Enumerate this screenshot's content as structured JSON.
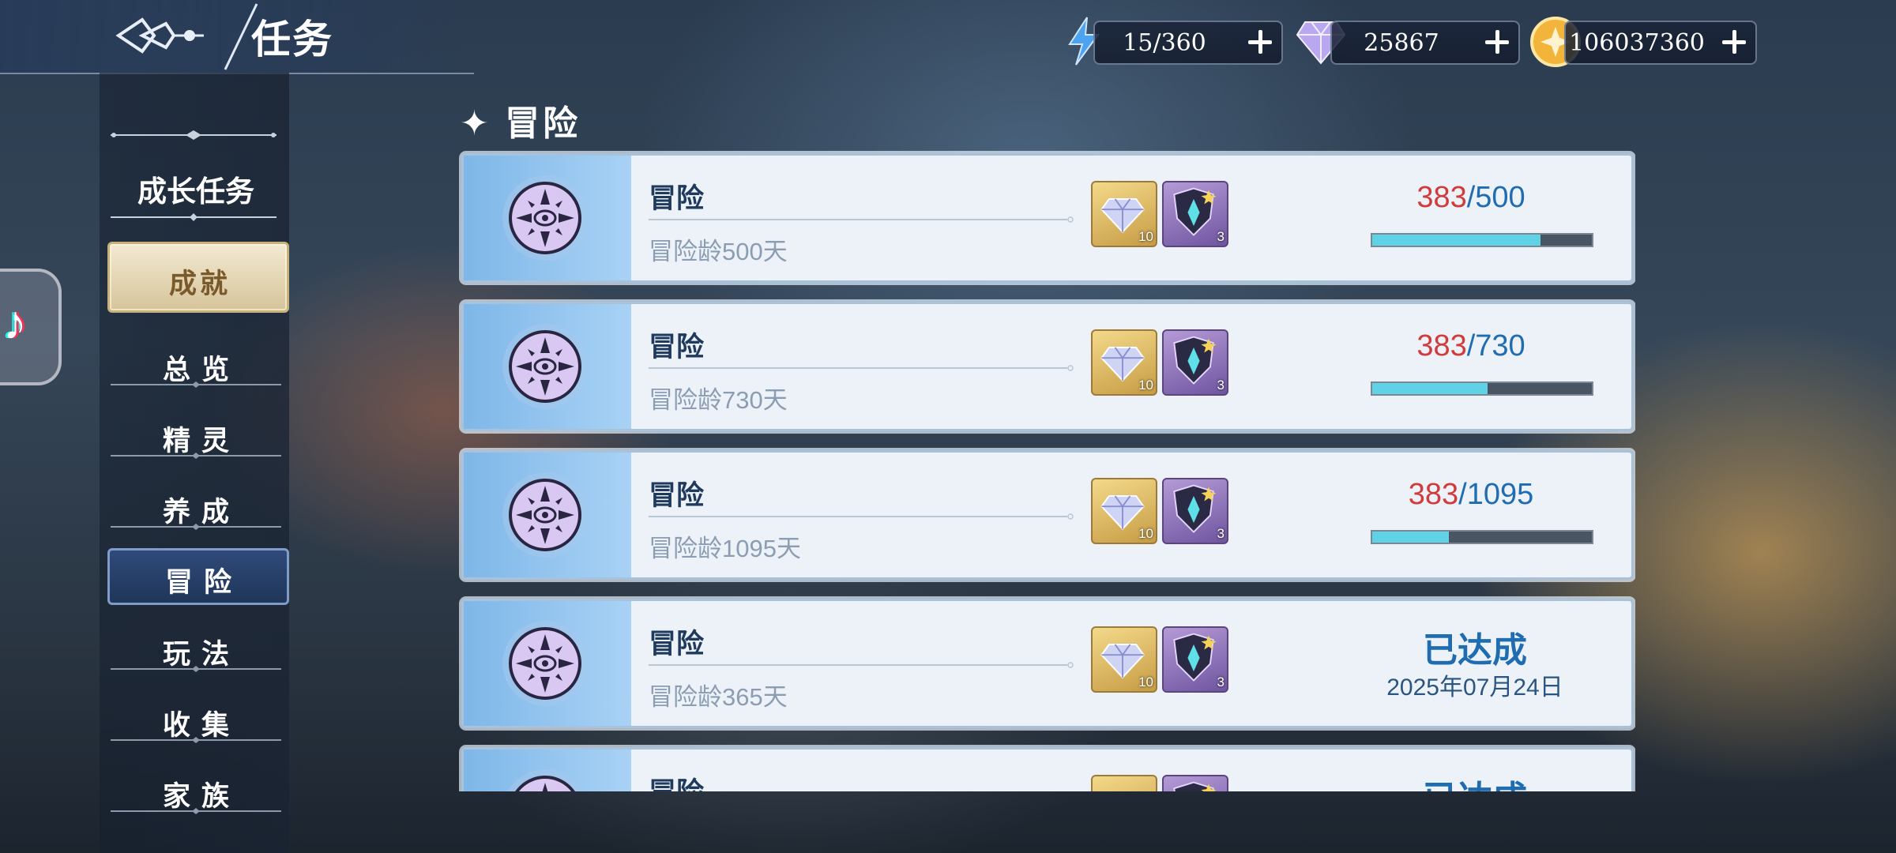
{
  "header": {
    "title": "任务"
  },
  "resources": [
    {
      "name": "stamina",
      "value": "15/360",
      "icon": "lightning-icon"
    },
    {
      "name": "diamond",
      "value": "25867",
      "icon": "diamond-icon"
    },
    {
      "name": "coin",
      "value": "106037360",
      "icon": "coin-icon"
    }
  ],
  "sidebar": {
    "header": "成长任务",
    "items": [
      {
        "label": "成就"
      },
      {
        "label": "总览"
      },
      {
        "label": "精灵"
      },
      {
        "label": "养成"
      },
      {
        "label": "冒险"
      },
      {
        "label": "玩法"
      },
      {
        "label": "收集"
      },
      {
        "label": "家族"
      }
    ]
  },
  "section": {
    "title": "冒险"
  },
  "tasks": [
    {
      "title": "冒险",
      "desc": "冒险龄500天",
      "rewards": [
        {
          "icon": "diamond-reward-icon",
          "count": "10"
        },
        {
          "icon": "crest-reward-icon",
          "count": "3"
        }
      ],
      "current": "383",
      "sep": "/",
      "max": "500",
      "progress": 0.766
    },
    {
      "title": "冒险",
      "desc": "冒险龄730天",
      "rewards": [
        {
          "icon": "diamond-reward-icon",
          "count": "10"
        },
        {
          "icon": "crest-reward-icon",
          "count": "3"
        }
      ],
      "current": "383",
      "sep": "/",
      "max": "730",
      "progress": 0.525
    },
    {
      "title": "冒险",
      "desc": "冒险龄1095天",
      "rewards": [
        {
          "icon": "diamond-reward-icon",
          "count": "10"
        },
        {
          "icon": "crest-reward-icon",
          "count": "3"
        }
      ],
      "current": "383",
      "sep": "/",
      "max": "1095",
      "progress": 0.35
    },
    {
      "title": "冒险",
      "desc": "冒险龄365天",
      "rewards": [
        {
          "icon": "diamond-reward-icon",
          "count": "10"
        },
        {
          "icon": "crest-reward-icon",
          "count": "3"
        }
      ],
      "status": "已达成",
      "date": "2025年07月24日"
    },
    {
      "title": "冒险",
      "desc": "",
      "rewards": [
        {
          "icon": "diamond-reward-icon",
          "count": ""
        },
        {
          "icon": "crest-reward-icon",
          "count": ""
        }
      ],
      "status": "已达成",
      "date": ""
    }
  ],
  "colors": {
    "progress_current": "#d03c3c",
    "progress_max": "#1f6db0",
    "bar_fill": "#5fd2e6",
    "card_bg": "#edf2f8"
  }
}
